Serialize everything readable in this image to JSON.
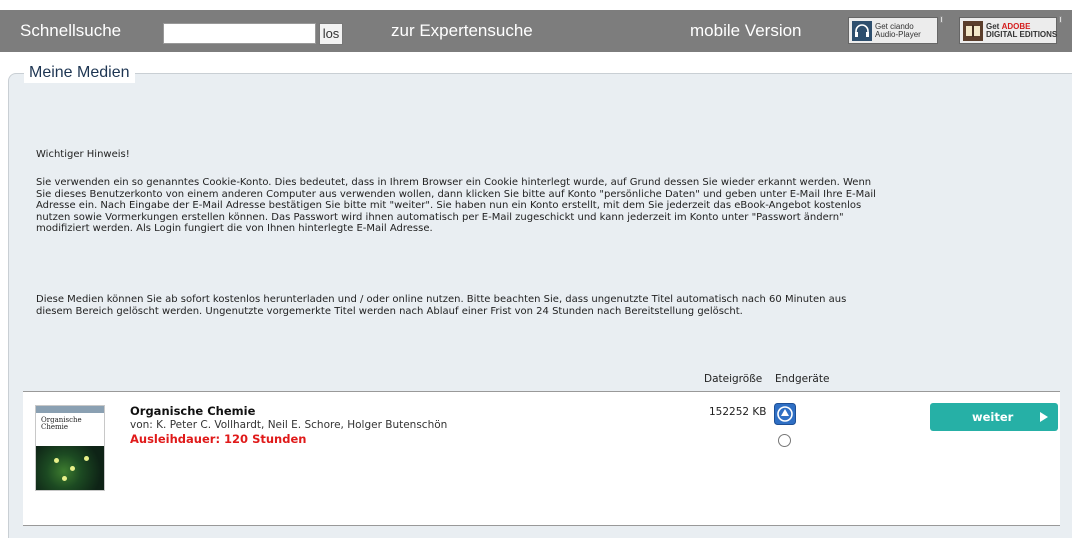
{
  "topbar": {
    "quick_search_label": "Schnellsuche",
    "search_value": "",
    "search_button": "los",
    "expert_search_label": "zur Expertensuche",
    "mobile_label": "mobile Version",
    "ciando_line1": "Get ciando",
    "ciando_line2": "Audio-Player",
    "adobe_line1_prefix": "Get",
    "adobe_line1_brand": "ADOBE",
    "adobe_line2": "DIGITAL EDITIONS"
  },
  "panel": {
    "legend": "Meine Medien",
    "notice_heading": "Wichtiger Hinweis!",
    "notice_lines": [
      "Sie verwenden ein so genanntes Cookie-Konto. Dies bedeutet, dass in Ihrem Browser ein Cookie hinterlegt wurde, auf Grund dessen Sie wieder erkannt werden. Wenn",
      "Sie dieses Benutzerkonto von einem anderen Computer aus verwenden wollen, dann klicken Sie bitte auf Konto \"persönliche Daten\" und geben unter E-Mail Ihre E-Mail",
      "Adresse ein. Nach Eingabe der E-Mail Adresse bestätigen Sie bitte mit \"weiter\". Sie haben nun ein Konto erstellt, mit dem Sie jederzeit das eBook-Angebot kostenlos",
      "nutzen sowie Vormerkungen erstellen können. Das Passwort wird ihnen automatisch per E-Mail zugeschickt und kann jederzeit im Konto unter \"Passwort ändern\"",
      "modifiziert werden. Als Login fungiert die von Ihnen hinterlegte E-Mail Adresse."
    ],
    "info_lines": [
      "Diese Medien können Sie ab sofort kostenlos herunterladen und / oder online nutzen. Bitte beachten Sie, dass ungenutzte Titel automatisch nach 60 Minuten aus",
      "diesem Bereich gelöscht werden. Ungenutzte vorgemerkte Titel werden nach Ablauf einer Frist von 24 Stunden nach Bereitstellung gelöscht."
    ],
    "col_filesize": "Dateigröße",
    "col_devices": "Endgeräte"
  },
  "media_item": {
    "cover_title": "Organische Chemie",
    "title": "Organische Chemie",
    "authors": "von: K. Peter C. Vollhardt, Neil E. Schore, Holger Butenschön",
    "loan_duration": "Ausleihdauer: 120 Stunden",
    "filesize": "152252 KB",
    "device_icon": "adobe-digital-editions-icon",
    "radio_selected": false,
    "button_label": "weiter"
  },
  "colors": {
    "topbar_bg": "#7d7d7d",
    "panel_bg": "#e9eef2",
    "accent_button": "#26b0a6",
    "loan_text": "#e01a1a",
    "legend_text": "#1d3552"
  }
}
